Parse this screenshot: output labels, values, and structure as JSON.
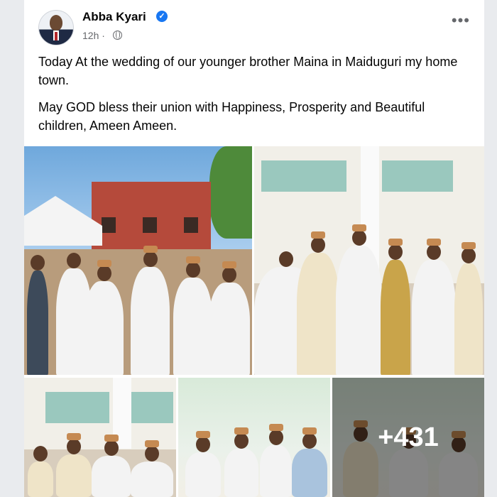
{
  "post": {
    "author": "Abba Kyari",
    "time": "12h",
    "more_label": "•••",
    "paragraphs": [
      "Today At the wedding of our younger brother Maina in Maiduguri my home town.",
      "May GOD bless their union with Happiness, Prosperity and Beautiful children, Ameen Ameen."
    ],
    "verified_mark": "✓",
    "extra_photos": "+431"
  },
  "colors": {
    "verified": "#1877f2",
    "meta_text": "#65676b",
    "body_text": "#050505"
  },
  "icons": [
    "verified-badge-icon",
    "globe-icon",
    "more-options-icon"
  ]
}
